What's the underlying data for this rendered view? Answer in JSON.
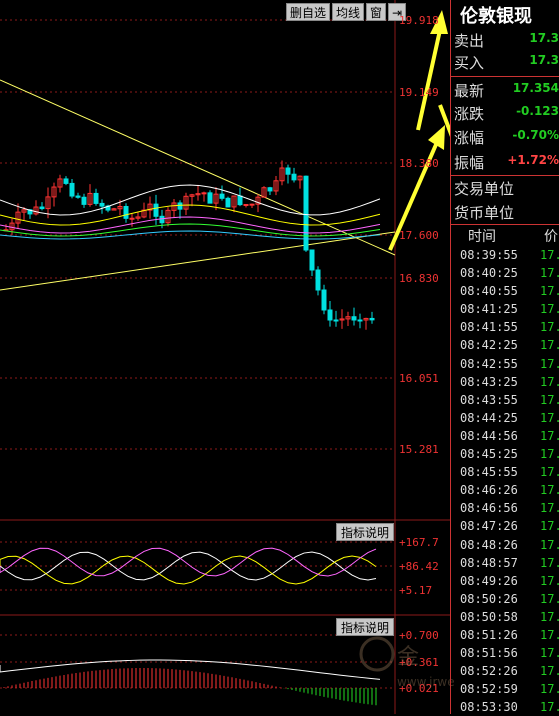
{
  "toolbar": {
    "delete_label": "删自选",
    "ma_label": "均线",
    "window_label": "窗",
    "arrow_label": "⇥"
  },
  "price_axis": [
    "19.918",
    "19.149",
    "18.380",
    "17.600",
    "16.830",
    "16.051",
    "15.281"
  ],
  "indicator1": {
    "button": "指标说明",
    "labels": [
      "+167.7",
      "+86.42",
      "+5.17"
    ]
  },
  "indicator2": {
    "button": "指标说明",
    "labels": [
      "+0.700",
      "+0.361",
      "+0.021"
    ]
  },
  "panel": {
    "title": "伦敦银现",
    "sell_label": "卖出",
    "sell_value": "17.3",
    "buy_label": "买入",
    "buy_value": "17.3",
    "latest_label": "最新",
    "latest_value": "17.354",
    "change_label": "涨跌",
    "change_value": "-0.123",
    "pct_label": "涨幅",
    "pct_value": "-0.70%",
    "amp_label": "振幅",
    "amp_value": "+1.72%",
    "trade_unit": "交易单位",
    "currency_unit": "货币单位",
    "col_time": "时间",
    "col_price": "价",
    "ticks": [
      {
        "time": "08:39:55",
        "price": "17."
      },
      {
        "time": "08:40:25",
        "price": "17."
      },
      {
        "time": "08:40:55",
        "price": "17."
      },
      {
        "time": "08:41:25",
        "price": "17."
      },
      {
        "time": "08:41:55",
        "price": "17."
      },
      {
        "time": "08:42:25",
        "price": "17."
      },
      {
        "time": "08:42:55",
        "price": "17."
      },
      {
        "time": "08:43:25",
        "price": "17."
      },
      {
        "time": "08:43:55",
        "price": "17."
      },
      {
        "time": "08:44:25",
        "price": "17."
      },
      {
        "time": "08:44:56",
        "price": "17."
      },
      {
        "time": "08:45:25",
        "price": "17."
      },
      {
        "time": "08:45:55",
        "price": "17."
      },
      {
        "time": "08:46:26",
        "price": "17."
      },
      {
        "time": "08:46:56",
        "price": "17."
      },
      {
        "time": "08:47:26",
        "price": "17."
      },
      {
        "time": "08:48:26",
        "price": "17."
      },
      {
        "time": "08:48:57",
        "price": "17."
      },
      {
        "time": "08:49:26",
        "price": "17."
      },
      {
        "time": "08:50:26",
        "price": "17."
      },
      {
        "time": "08:50:58",
        "price": "17."
      },
      {
        "time": "08:51:26",
        "price": "17."
      },
      {
        "time": "08:51:56",
        "price": "17."
      },
      {
        "time": "08:52:26",
        "price": "17."
      },
      {
        "time": "08:52:59",
        "price": "17."
      },
      {
        "time": "08:53:30",
        "price": "17."
      }
    ]
  },
  "watermark": {
    "text": "金",
    "site": "www.jrwe"
  },
  "colors": {
    "up": "#ff3333",
    "down": "#00e0e0",
    "grid": "#8b1a1a",
    "annotation": "#ffff33"
  }
}
